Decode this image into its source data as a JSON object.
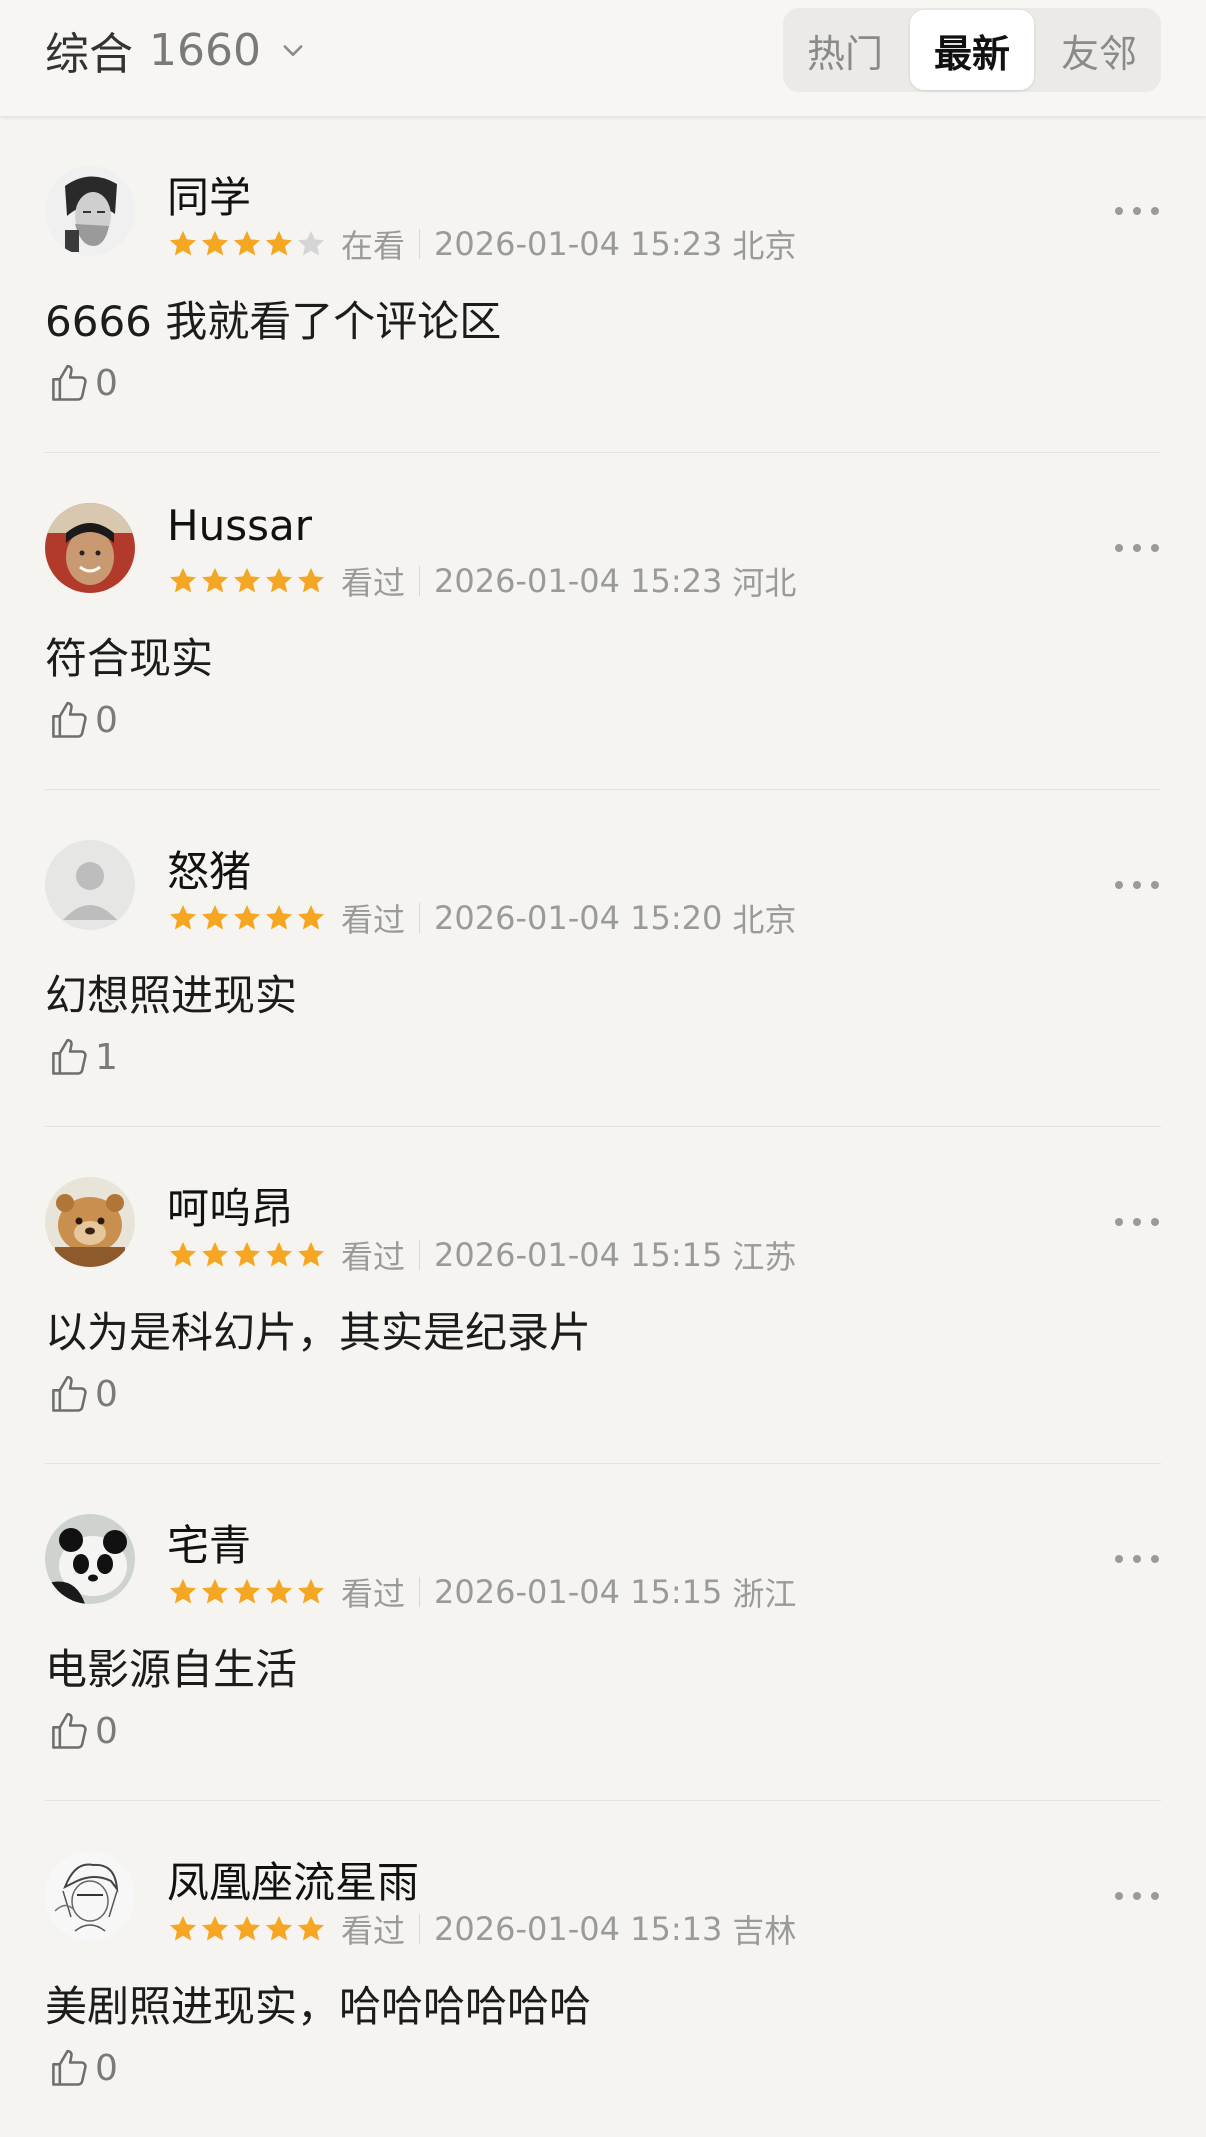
{
  "header": {
    "filter_label": "综合",
    "filter_count": "1660",
    "tabs": [
      {
        "label": "热门",
        "active": false
      },
      {
        "label": "最新",
        "active": true
      },
      {
        "label": "友邻",
        "active": false
      }
    ]
  },
  "colors": {
    "star_filled": "#f5a623",
    "star_empty": "#d5d5d5",
    "background": "#f5f4f0"
  },
  "comments": [
    {
      "username": "同学",
      "rating": 4,
      "status": "在看",
      "time": "2026-01-04 15:23",
      "location": "北京",
      "text": "6666 我就看了个评论区",
      "likes": "0",
      "avatar": "portrait-man-avatar"
    },
    {
      "username": "Hussar",
      "rating": 5,
      "status": "看过",
      "time": "2026-01-04 15:23",
      "location": "河北",
      "text": "符合现实",
      "likes": "0",
      "avatar": "smiling-boy-avatar"
    },
    {
      "username": "怒猪",
      "rating": 5,
      "status": "看过",
      "time": "2026-01-04 15:20",
      "location": "北京",
      "text": "幻想照进现实",
      "likes": "1",
      "avatar": "default-user-avatar"
    },
    {
      "username": "呵呜昂",
      "rating": 5,
      "status": "看过",
      "time": "2026-01-04 15:15",
      "location": "江苏",
      "text": "以为是科幻片，其实是纪录片",
      "likes": "0",
      "avatar": "lion-cub-avatar"
    },
    {
      "username": "宅青",
      "rating": 5,
      "status": "看过",
      "time": "2026-01-04 15:15",
      "location": "浙江",
      "text": "电影源自生活",
      "likes": "0",
      "avatar": "panda-avatar"
    },
    {
      "username": "凤凰座流星雨",
      "rating": 5,
      "status": "看过",
      "time": "2026-01-04 15:13",
      "location": "吉林",
      "text": "美剧照进现实，哈哈哈哈哈哈",
      "likes": "0",
      "avatar": "sketch-character-avatar"
    }
  ]
}
